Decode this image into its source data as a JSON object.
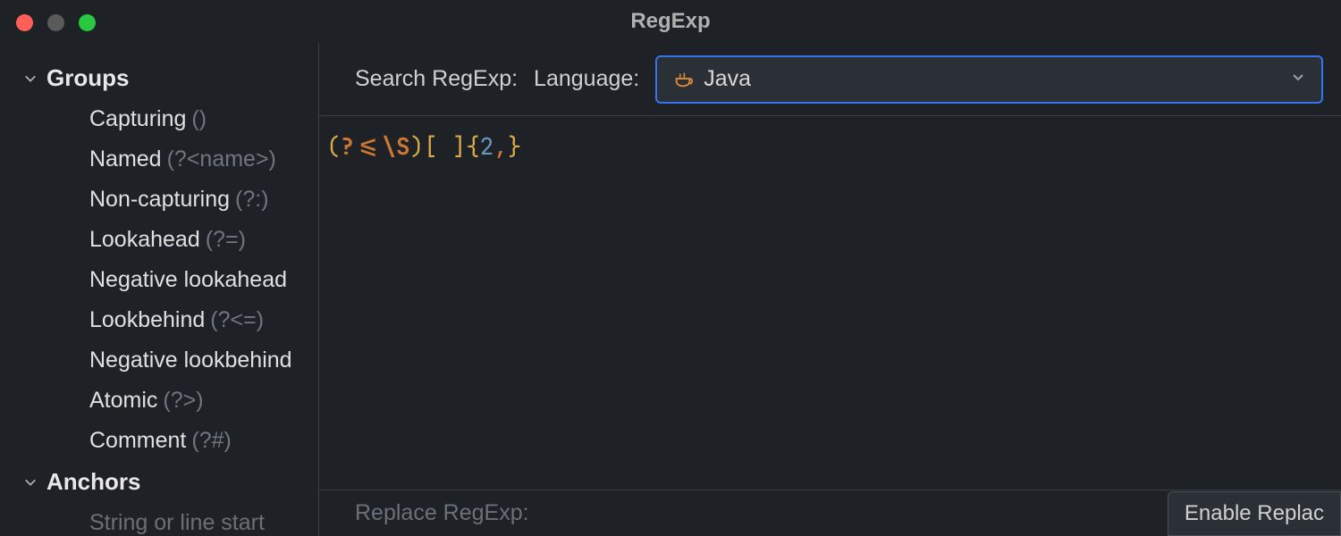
{
  "window": {
    "title": "RegExp"
  },
  "sidebar": {
    "groups": {
      "label": "Groups",
      "items": [
        {
          "label": "Capturing",
          "hint": "()"
        },
        {
          "label": "Named",
          "hint": "(?<name>)"
        },
        {
          "label": "Non-capturing",
          "hint": "(?:)"
        },
        {
          "label": "Lookahead",
          "hint": "(?=)"
        },
        {
          "label": "Negative lookahead",
          "hint": ""
        },
        {
          "label": "Lookbehind",
          "hint": "(?<=)"
        },
        {
          "label": "Negative lookbehind",
          "hint": ""
        },
        {
          "label": "Atomic",
          "hint": "(?>)"
        },
        {
          "label": "Comment",
          "hint": "(?#)"
        }
      ]
    },
    "anchors": {
      "label": "Anchors",
      "first_item_partial": "String or line start"
    }
  },
  "toolbar": {
    "search_label": "Search RegExp:",
    "language_label": "Language:",
    "language_value": "Java"
  },
  "editor": {
    "tokens": [
      {
        "cls": "tok-paren",
        "t": "("
      },
      {
        "cls": "tok-esc",
        "t": "?<=\\S"
      },
      {
        "cls": "tok-paren",
        "t": ")"
      },
      {
        "cls": "tok-paren",
        "t": "["
      },
      {
        "cls": "",
        "t": " "
      },
      {
        "cls": "tok-paren",
        "t": "]"
      },
      {
        "cls": "tok-brace",
        "t": "{"
      },
      {
        "cls": "tok-num",
        "t": "2"
      },
      {
        "cls": "tok-comma",
        "t": ","
      },
      {
        "cls": "tok-brace",
        "t": "}"
      }
    ],
    "raw": "(?<=\\S)[ ]{2,}"
  },
  "bottom": {
    "replace_label": "Replace RegExp:",
    "enable_button": "Enable Replac"
  }
}
